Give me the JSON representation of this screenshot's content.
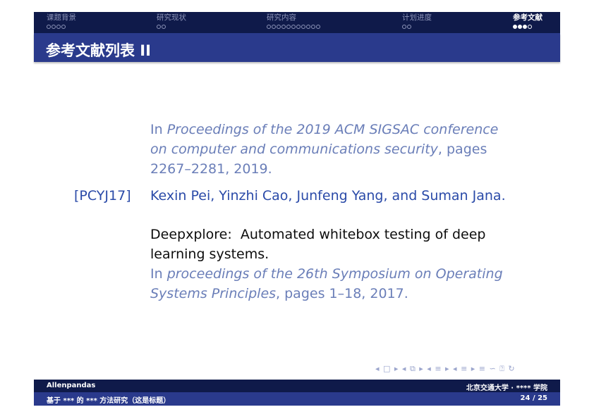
{
  "nav": {
    "sections": [
      {
        "label": "课题背景",
        "dots": 4,
        "filled": 0,
        "active": false
      },
      {
        "label": "研究现状",
        "dots": 2,
        "filled": 0,
        "active": false
      },
      {
        "label": "研究内容",
        "dots": 11,
        "filled": 0,
        "active": false
      },
      {
        "label": "计划进度",
        "dots": 2,
        "filled": 0,
        "active": false
      },
      {
        "label": "参考文献",
        "dots": 4,
        "filled": 3,
        "active": true
      }
    ]
  },
  "frame": {
    "title": "参考文献列表 II"
  },
  "references": {
    "continued": {
      "prefix": "In ",
      "venue_line1": "Proceedings of the 2019 ACM SIGSAC conference",
      "venue_line2": "on computer and communications security",
      "pages_line2": ", pages",
      "line3": "2267–2281, 2019."
    },
    "pcyj17": {
      "key": "[PCYJ17]",
      "authors": "Kexin Pei, Yinzhi Cao, Junfeng Yang, and Suman Jana.",
      "title_line1": "Deepxplore:  Automated whitebox testing of deep",
      "title_line2": "learning systems.",
      "in_prefix": "In ",
      "venue_line1": "proceedings of the 26th Symposium on Operating",
      "venue_line2": "Systems Principles",
      "tail": ", pages 1–18, 2017."
    }
  },
  "beamer_nav": {
    "symbols": "◂ □ ▸ ◂ ⧉ ▸ ◂ ≡ ▸ ◂ ≡ ▸  ≡  ∽ ⍰ ↻"
  },
  "footer": {
    "author": "Allenpandas",
    "institute": "北京交通大学 · **** 学院",
    "talk_title": "基于 *** 的 *** 方法研究（这是标题）",
    "page": "24 / 25"
  },
  "colors": {
    "nav_bg": "#0f1a4a",
    "title_bg": "#2a3a8c",
    "ref_blue": "#2a4aa8"
  }
}
